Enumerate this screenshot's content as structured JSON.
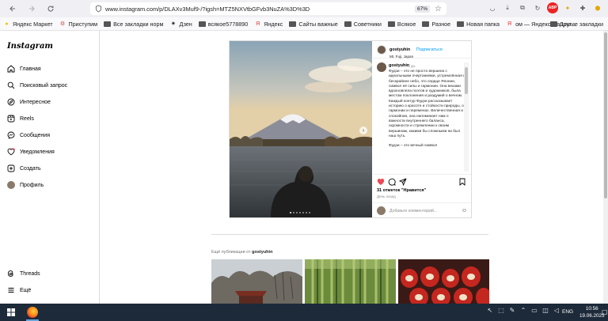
{
  "browser": {
    "url": "www.instagram.com/p/DLAXv3Muf9-/?igsh=MTZ5NXVtbGFvb3NuZA%3D%3D",
    "zoom": "67%"
  },
  "bookmarks": [
    {
      "label": "Яндекс Маркет",
      "icon": "market-icon"
    },
    {
      "label": "Приступим",
      "icon": "gear-icon"
    },
    {
      "label": "Все закладки норм",
      "icon": "folder-icon"
    },
    {
      "label": "Дзен",
      "icon": "dzen-icon"
    },
    {
      "label": "всякое5778890",
      "icon": "folder-icon"
    },
    {
      "label": "Яндекс",
      "icon": "yandex-icon"
    },
    {
      "label": "Сайты важные",
      "icon": "folder-icon"
    },
    {
      "label": "Советники",
      "icon": "folder-icon"
    },
    {
      "label": "Всякое",
      "icon": "folder-icon"
    },
    {
      "label": "Разное",
      "icon": "folder-icon"
    },
    {
      "label": "Новая папка",
      "icon": "folder-icon"
    },
    {
      "label": "ом — Яндекс: нашло...",
      "icon": "yandex-icon"
    }
  ],
  "bookmarks_other": "Другие закладки",
  "sidebar": {
    "logo": "Instagram",
    "items": [
      {
        "label": "Главная",
        "icon": "home-icon"
      },
      {
        "label": "Поисковый запрос",
        "icon": "search-icon"
      },
      {
        "label": "Интересное",
        "icon": "compass-icon"
      },
      {
        "label": "Reels",
        "icon": "reels-icon"
      },
      {
        "label": "Сообщения",
        "icon": "messenger-icon"
      },
      {
        "label": "Уведомления",
        "icon": "heart-icon"
      },
      {
        "label": "Создать",
        "icon": "plus-icon"
      },
      {
        "label": "Профиль",
        "icon": "avatar"
      }
    ],
    "bottom": [
      {
        "label": "Threads",
        "icon": "threads-icon"
      },
      {
        "label": "Ещё",
        "icon": "menu-icon"
      }
    ]
  },
  "post": {
    "username": "gostyuhin",
    "follow_label": "Подписаться",
    "location": "Mt. Fuji, Japan",
    "time": "1 дн.",
    "caption": "Фудзи – это не просто вершина с идеальными очертаниями, устремлённая в бескрайнее небо, это сердце Японии, символ её силы и гармонии. Она веками вдохновляла поэтов и художников, была местом поклонения и раздумий о вечном. Каждый контур Фудзи рассказывает историю о красоте и стойкости природы, о гармонии и переменах. Величественная и спокойная, она напоминает нам о важности внутреннего баланса, скромности и стремлении к своим вершинам, какими бы сложными ни был наш путь.\n\nФудзи – это вечный символ",
    "likes": "31 отметок \"Нравится\"",
    "date": "День назад",
    "comment_placeholder": "Добавьте комментарий...",
    "photo_dots": 7,
    "active_dot": 0
  },
  "more_posts": {
    "prefix": "Ещё публикации от",
    "username": "gostyuhin"
  },
  "taskbar": {
    "lang": "ENG",
    "time": "10:56",
    "date": "19.06.2025"
  },
  "colors": {
    "accent_blue": "#0095f6",
    "like_red": "#ed4956",
    "taskbar": "#1c2a3a"
  }
}
